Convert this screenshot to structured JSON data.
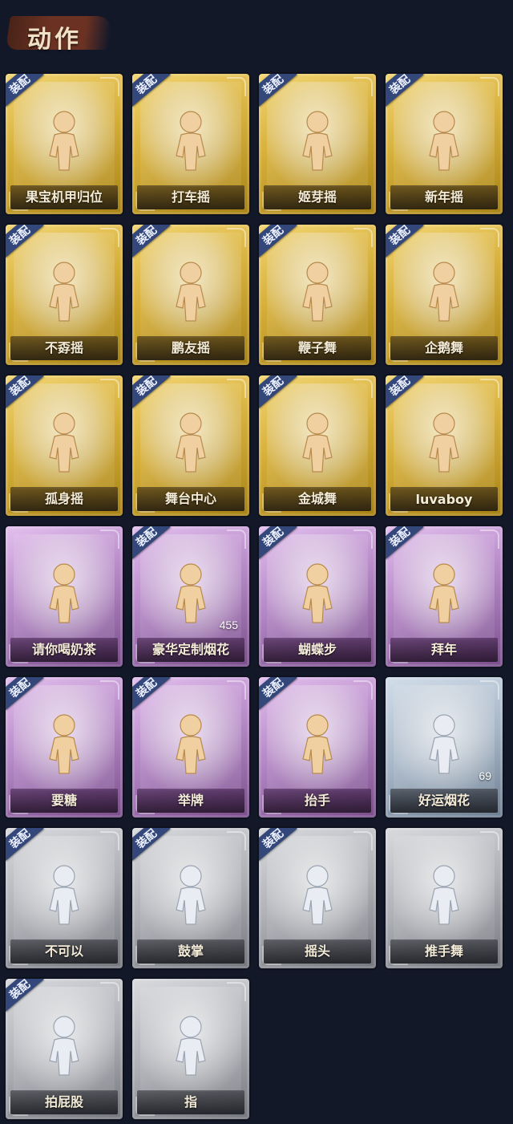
{
  "header": {
    "title": "动作"
  },
  "equip_label": "装配",
  "cards": [
    {
      "label": "果宝机甲归位",
      "rarity": "gold",
      "equipped": true,
      "icon": "dance-figure-icon"
    },
    {
      "label": "打车摇",
      "rarity": "gold",
      "equipped": true,
      "icon": "dance-figure-icon"
    },
    {
      "label": "姬芽摇",
      "rarity": "gold",
      "equipped": true,
      "icon": "dance-figure-icon"
    },
    {
      "label": "新年摇",
      "rarity": "gold",
      "equipped": true,
      "icon": "dance-figure-icon"
    },
    {
      "label": "不孬摇",
      "rarity": "gold",
      "equipped": true,
      "icon": "dance-figure-icon"
    },
    {
      "label": "鹏友摇",
      "rarity": "gold",
      "equipped": true,
      "icon": "dance-figure-icon"
    },
    {
      "label": "鞭子舞",
      "rarity": "gold",
      "equipped": true,
      "icon": "dance-figure-icon"
    },
    {
      "label": "企鹅舞",
      "rarity": "gold",
      "equipped": true,
      "icon": "dance-figure-icon"
    },
    {
      "label": "孤身摇",
      "rarity": "gold",
      "equipped": true,
      "icon": "dance-figure-icon"
    },
    {
      "label": "舞台中心",
      "rarity": "gold",
      "equipped": true,
      "icon": "dance-figure-icon"
    },
    {
      "label": "金城舞",
      "rarity": "gold",
      "equipped": true,
      "icon": "dance-figure-icon"
    },
    {
      "label": "luvaboy",
      "rarity": "gold",
      "equipped": true,
      "icon": "dance-figure-icon"
    },
    {
      "label": "请你喝奶茶",
      "rarity": "purple",
      "equipped": false,
      "icon": "milk-tea-figure-icon"
    },
    {
      "label": "豪华定制烟花",
      "rarity": "purple",
      "equipped": true,
      "icon": "fireworks-icon",
      "count": "455"
    },
    {
      "label": "蝴蝶步",
      "rarity": "purple",
      "equipped": true,
      "icon": "dance-figure-icon"
    },
    {
      "label": "拜年",
      "rarity": "purple",
      "equipped": true,
      "icon": "greeting-figure-icon"
    },
    {
      "label": "要糖",
      "rarity": "purple",
      "equipped": true,
      "icon": "figure-icon"
    },
    {
      "label": "举牌",
      "rarity": "purple",
      "equipped": true,
      "icon": "sign-figure-icon"
    },
    {
      "label": "抬手",
      "rarity": "purple",
      "equipped": true,
      "icon": "figure-icon"
    },
    {
      "label": "好运烟花",
      "rarity": "blue",
      "equipped": false,
      "icon": "firework-can-icon",
      "count": "69"
    },
    {
      "label": "不可以",
      "rarity": "grey",
      "equipped": true,
      "icon": "finger-wag-icon"
    },
    {
      "label": "鼓掌",
      "rarity": "grey",
      "equipped": true,
      "icon": "clap-icon"
    },
    {
      "label": "摇头",
      "rarity": "grey",
      "equipped": true,
      "icon": "figure-icon"
    },
    {
      "label": "推手舞",
      "rarity": "grey",
      "equipped": false,
      "icon": "figure-icon"
    },
    {
      "label": "拍屁股",
      "rarity": "grey",
      "equipped": true,
      "icon": "figure-icon"
    },
    {
      "label": "指",
      "rarity": "grey",
      "equipped": false,
      "icon": "point-hand-icon"
    }
  ]
}
